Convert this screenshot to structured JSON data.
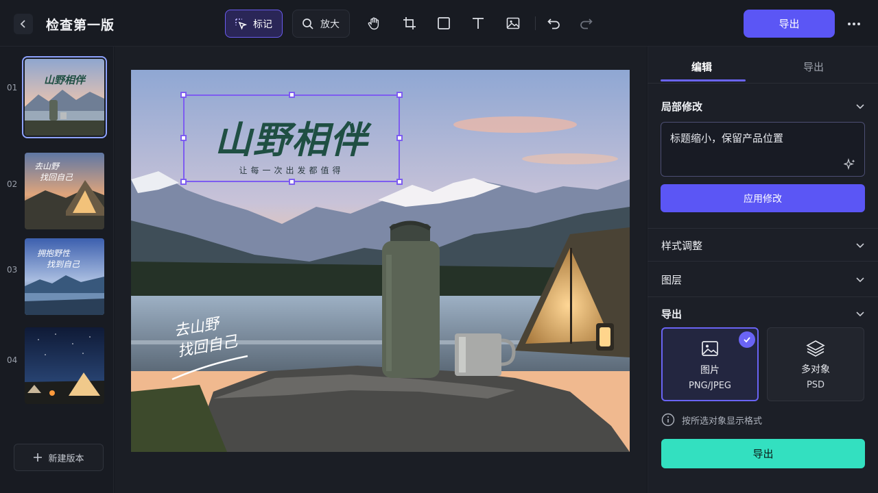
{
  "header": {
    "title": "检查第一版",
    "tools": {
      "mark_label": "标记",
      "zoom_label": "放大"
    },
    "export_label": "导出"
  },
  "versions": {
    "items": [
      {
        "number": "01"
      },
      {
        "number": "02"
      },
      {
        "number": "03"
      },
      {
        "number": "04"
      }
    ],
    "thumb_texts": {
      "t1_title": "山野相伴",
      "t2_line1": "去山野",
      "t2_line2": "找回自己",
      "t3_line1": "拥抱野性",
      "t3_line2": "找到自己"
    },
    "new_version_label": "新建版本"
  },
  "canvas": {
    "headline": "山野相伴",
    "subline": "让每一次出发都值得",
    "hand_line1": "去山野",
    "hand_line2": "找回自己"
  },
  "panel": {
    "tabs": [
      "编辑",
      "导出"
    ],
    "local_edit_title": "局部修改",
    "prompt_text": "标题缩小，保留产品位置",
    "apply_label": "应用修改",
    "style_title": "样式调整",
    "layers_title": "图层",
    "export_title": "导出",
    "format_image_label": "图片",
    "format_image_type": "PNG/JPEG",
    "format_multi_label": "多对象",
    "format_multi_type": "PSD",
    "hint": "按所选对象显示格式",
    "export_button": "导出"
  },
  "colors": {
    "accent": "#5b56f5",
    "export_green": "#33e0c0",
    "selection": "#7d5cf0"
  }
}
